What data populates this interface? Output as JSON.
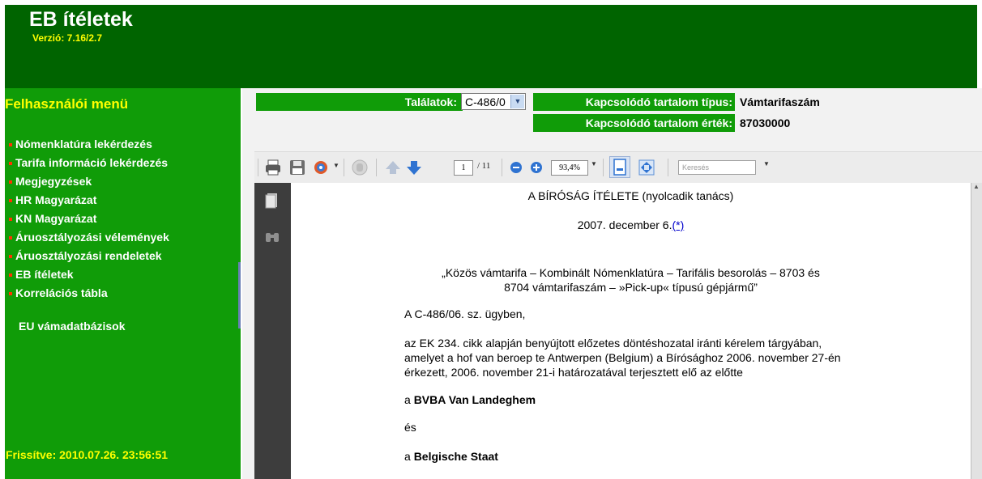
{
  "header": {
    "title": "EB ítéletek",
    "version": "Verzió: 7.16/2.7"
  },
  "sidebar": {
    "title": "Felhasználói menü",
    "items": [
      {
        "label": "Nómenklatúra lekérdezés"
      },
      {
        "label": "Tarifa információ lekérdezés"
      },
      {
        "label": "Megjegyzések"
      },
      {
        "label": "HR Magyarázat"
      },
      {
        "label": "KN Magyarázat"
      },
      {
        "label": "Áruosztályozási vélemények"
      },
      {
        "label": "Áruosztályozási rendeletek"
      },
      {
        "label": "EB ítéletek"
      },
      {
        "label": "Korrelációs tábla"
      }
    ],
    "eu_link": "EU vámadatbázisok",
    "updated": "Frissítve:  2010.07.26. 23:56:51"
  },
  "filters": {
    "talalatok_label": "Találatok:",
    "talalatok_value": "C-486/0",
    "type_label": "Kapcsolódó tartalom típus:",
    "type_value": "Vámtarifaszám",
    "value_label": "Kapcsolódó tartalom érték:",
    "value_value": "87030000"
  },
  "viewer_toolbar": {
    "page_current": "1",
    "page_total": "/ 11",
    "zoom": "93,4%",
    "search_placeholder": "Keresés",
    "icons": [
      "print-icon",
      "save-icon",
      "tools-icon",
      "hand-icon",
      "prev-page-icon",
      "next-page-icon",
      "zoom-out-icon",
      "zoom-in-icon",
      "single-page-icon",
      "fit-page-icon"
    ]
  },
  "document": {
    "heading": "A BÍRÓSÁG ÍTÉLETE (nyolcadik tanács)",
    "date": "2007. december 6.",
    "date_ref": "(*)",
    "subject_line1": "„Közös vámtarifa – Kombinált Nómenklatúra – Tarifális besorolás – 8703 és",
    "subject_line2": "8704 vámtarifaszám – »Pick-up« típusú gépjármű”",
    "case_line": "A C-486/06. sz. ügyben,",
    "para_line1": "az EK 234. cikk alapján benyújtott előzetes döntéshozatal iránti kérelem tárgyában,",
    "para_line2": "amelyet a hof van beroep te Antwerpen (Belgium) a Bírósághoz 2006. november 27-én",
    "para_line3": "érkezett, 2006. november 21-i határozatával terjesztett elő az előtte",
    "party1_prefix": "a ",
    "party1_name": "BVBA Van Landeghem",
    "and_text": "és",
    "party2_prefix": "a ",
    "party2_name": "Belgische Staat"
  },
  "colors": {
    "header_bg": "#006400",
    "sidebar_bg": "#109c08",
    "accent_yellow": "#ffff00",
    "bullet_red": "#ff3300"
  }
}
